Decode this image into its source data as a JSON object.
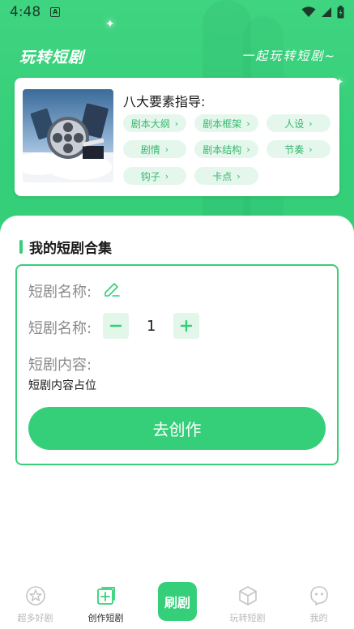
{
  "status_bar": {
    "time": "4:48",
    "notif_letter": "A"
  },
  "header": {
    "title": "玩转短剧",
    "slogan": "一起玩转短剧~"
  },
  "guide": {
    "heading": "八大要素指导:",
    "chips": [
      {
        "label": "剧本大纲"
      },
      {
        "label": "剧本框架"
      },
      {
        "label": "人设"
      },
      {
        "label": "剧情"
      },
      {
        "label": "剧本结构"
      },
      {
        "label": "节奏"
      },
      {
        "label": "钩子"
      },
      {
        "label": "卡点"
      }
    ]
  },
  "collection": {
    "title": "我的短剧合集",
    "name_label": "短剧名称:",
    "count_label": "短剧名称:",
    "count_value": "1",
    "content_label": "短剧内容:",
    "content_placeholder": "短剧内容占位",
    "create_button": "去创作"
  },
  "tabbar": {
    "tabs": [
      {
        "label": "超多好剧"
      },
      {
        "label": "创作短剧"
      },
      {
        "label": "刷剧"
      },
      {
        "label": "玩转短剧"
      },
      {
        "label": "我的"
      }
    ]
  },
  "colors": {
    "accent": "#35cf79",
    "chip_bg": "#e5f7ec",
    "chip_text": "#34b86c"
  }
}
